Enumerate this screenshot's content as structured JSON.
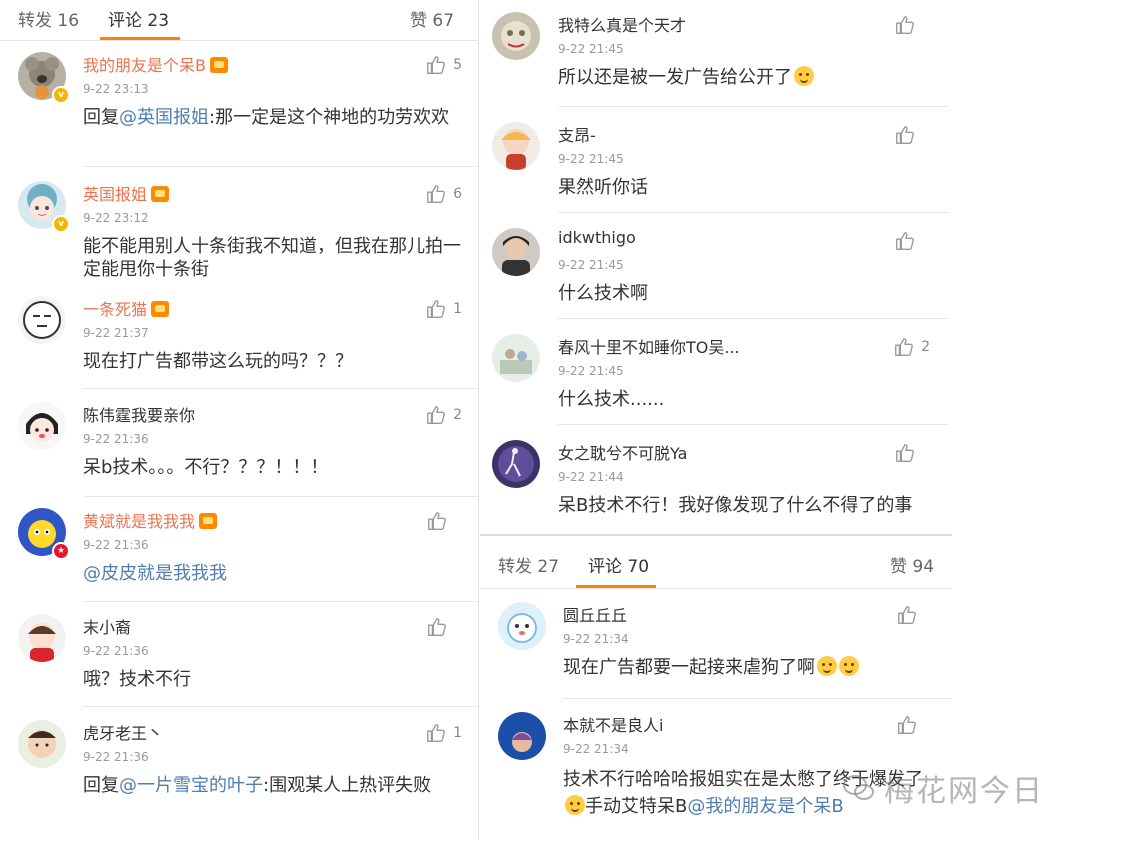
{
  "left_panel": {
    "tabs": {
      "repost": "转发 16",
      "comment": "评论 23",
      "like": "赞 67"
    },
    "comments": [
      {
        "name": "我的朋友是个呆B",
        "time": "9-22 23:13",
        "likes": "5",
        "reply_prefix": "回复",
        "mention": "@英国报姐",
        "text": ":那一定是这个神地的功劳欢欢"
      },
      {
        "name": "英国报姐",
        "time": "9-22 23:12",
        "likes": "6",
        "text": "能不能用别人十条街我不知道，但我在那儿拍一定能甩你十条街"
      },
      {
        "name": "一条死猫",
        "time": "9-22 21:37",
        "likes": "1",
        "text": "现在打广告都带这么玩的吗？？？"
      },
      {
        "name": "陈伟霆我要亲你",
        "time": "9-22 21:36",
        "likes": "2",
        "text": "呆b技术。。。不行？？？！！！"
      },
      {
        "name": "黄斌就是我我我",
        "time": "9-22 21:36",
        "likes": "",
        "mention": "@皮皮就是我我我"
      },
      {
        "name": "末小裔",
        "time": "9-22 21:36",
        "likes": "",
        "text": "哦？技术不行"
      },
      {
        "name": "虎牙老王丶",
        "time": "9-22 21:36",
        "likes": "1",
        "reply_prefix": "回复",
        "mention": "@一片雪宝的叶子",
        "text": ":围观某人上热评失败"
      }
    ]
  },
  "right_top_panel": {
    "comments": [
      {
        "name": "我特么真是个天才",
        "time": "9-22 21:45",
        "likes": "",
        "text": "所以还是被一发广告给公开了"
      },
      {
        "name": "支昂-",
        "time": "9-22 21:45",
        "likes": "",
        "text": "果然听你话"
      },
      {
        "name": "idkwthigo",
        "time": "9-22 21:45",
        "likes": "",
        "text": "什么技术啊"
      },
      {
        "name": "春风十里不如睡你TO吴...",
        "time": "9-22 21:45",
        "likes": "2",
        "text": "什么技术......"
      },
      {
        "name": "女之耽兮不可脱Ya",
        "time": "9-22 21:44",
        "likes": "",
        "text": "呆B技术不行！我好像发现了什么不得了的事"
      }
    ]
  },
  "right_bottom_panel": {
    "tabs": {
      "repost": "转发 27",
      "comment": "评论 70",
      "like": "赞 94"
    },
    "comments": [
      {
        "name": "圆丘丘丘",
        "time": "9-22 21:34",
        "likes": "",
        "text": "现在广告都要一起接来虐狗了啊"
      },
      {
        "name": "本就不是良人i",
        "time": "9-22 21:34",
        "likes": "",
        "text": "技术不行哈哈哈报姐实在是太憋了终于爆发了",
        "text2": "手动艾特呆B",
        "mention": "@我的朋友是个呆B"
      }
    ]
  },
  "watermark": {
    "text": "梅花网今日"
  },
  "colors": {
    "accent": "#ff8200",
    "vip_name": "#eb7350",
    "mention": "#507daf",
    "time": "#999999"
  }
}
